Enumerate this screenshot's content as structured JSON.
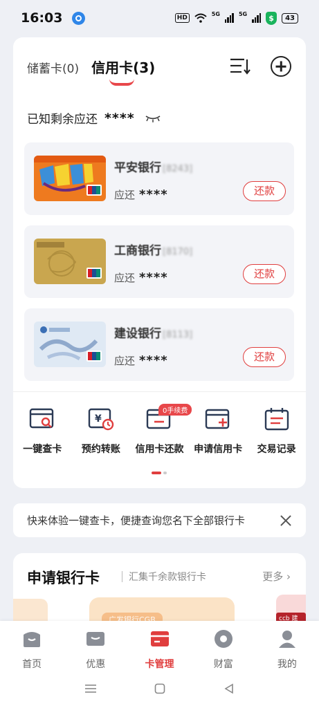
{
  "status": {
    "time": "16:03",
    "hd": "HD",
    "net1": "5G",
    "net2": "5G",
    "shield": "$",
    "battery": "43"
  },
  "tabs": {
    "debit": "储蓄卡(0)",
    "credit": "信用卡(3)"
  },
  "summary": {
    "label": "已知剩余应还",
    "mask": "****"
  },
  "cards": [
    {
      "bank": "平安银行",
      "num": "[8243]",
      "due_label": "应还",
      "due_mask": "****",
      "btn": "还款"
    },
    {
      "bank": "工商银行",
      "num": "[8170]",
      "due_label": "应还",
      "due_mask": "****",
      "btn": "还款"
    },
    {
      "bank": "建设银行",
      "num": "[8113]",
      "due_label": "应还",
      "due_mask": "****",
      "btn": "还款"
    }
  ],
  "functions": [
    {
      "label": "一键查卡",
      "icon": "card-search-icon"
    },
    {
      "label": "预约转账",
      "icon": "scheduled-transfer-icon"
    },
    {
      "label": "信用卡还款",
      "icon": "card-repay-icon"
    },
    {
      "label": "申请信用卡",
      "icon": "card-apply-icon"
    },
    {
      "label": "交易记录",
      "icon": "calendar-record-icon"
    }
  ],
  "badge": "0手续费",
  "tip": {
    "text": "快来体验一键查卡，便捷查询您名下全部银行卡"
  },
  "apply": {
    "title": "申请银行卡",
    "subtitle": "汇集千余款银行卡",
    "more": "更多",
    "promo_tag": "广发银行CGB",
    "promo3_tag": "ccb 建文"
  },
  "tabbar": [
    {
      "label": "首页",
      "icon": "home-icon"
    },
    {
      "label": "优惠",
      "icon": "coupon-icon"
    },
    {
      "label": "卡管理",
      "icon": "card-manage-icon"
    },
    {
      "label": "财富",
      "icon": "wealth-icon"
    },
    {
      "label": "我的",
      "icon": "profile-icon"
    }
  ],
  "colors": {
    "accent": "#e03e3e",
    "bg": "#eef0f5"
  }
}
